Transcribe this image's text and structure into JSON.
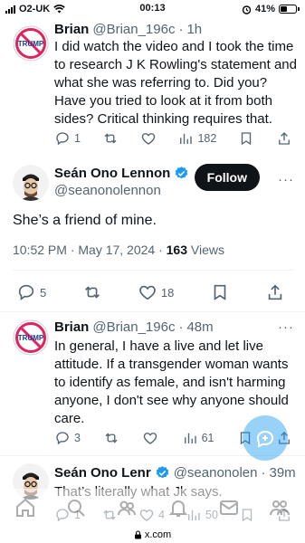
{
  "status_bar": {
    "carrier": "O2-UK",
    "time": "00:13",
    "battery": "41%",
    "battery_level": 0.41
  },
  "tweet1": {
    "name": "Brian",
    "handle": "@Brian_196c",
    "dot": "·",
    "age": "1h",
    "text": "I did watch the video and I took the time to research J K Rowling's statement and what she was referring to. Did you? Have you tried to look at it from both sides? Critical thinking requires that.",
    "replies": "1",
    "views": "182",
    "avatar_text": "TRUMP"
  },
  "main_tweet": {
    "name": "Seán Ono Lennon",
    "handle": "@seanonolennon",
    "follow_label": "Follow",
    "more": "···",
    "text": "She’s a friend of mine.",
    "timestamp": "10:52 PM · May 17, 2024 · ",
    "views_count": "163",
    "views_label": " Views",
    "replies": "5",
    "likes": "18"
  },
  "tweet2": {
    "name": "Brian",
    "handle": "@Brian_196c",
    "dot": "·",
    "age": "48m",
    "text": "In general, I have a live and let live attitude. If a transgender woman wants to identify as female, and isn't harming anyone, I don't see why anyone should care.",
    "replies": "3",
    "views": "61",
    "avatar_text": "TRUMP"
  },
  "tweet3": {
    "name": "Seán Ono Lenr",
    "handle": "@seanonolen",
    "dot": "·",
    "age": "39m",
    "text": "That’s literally what Jk says.",
    "replies": "1",
    "likes": "4",
    "views": "50"
  },
  "more_dots": "···",
  "browser": {
    "url": "x.com"
  },
  "colors": {
    "accent": "#1d9bf0",
    "text": "#0f1419",
    "muted": "#536471"
  }
}
